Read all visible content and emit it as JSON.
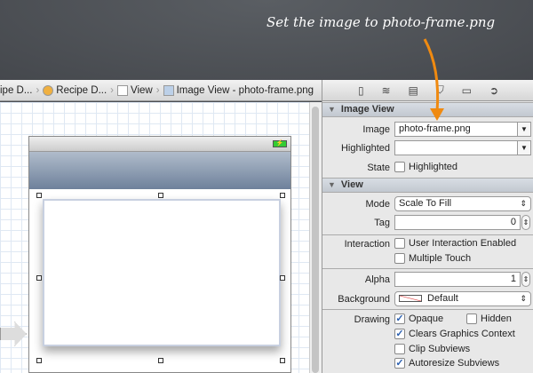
{
  "annotation": "Set the image to photo-frame.png",
  "colors": {
    "arrow": "#f08a10",
    "battery": "#33cc33"
  },
  "breadcrumb": [
    {
      "label": "ipe D...",
      "icon": "storyboard-icon"
    },
    {
      "label": "Recipe D...",
      "icon": "view-controller-icon"
    },
    {
      "label": "View",
      "icon": "view-icon"
    },
    {
      "label": "Image View - photo-frame.png",
      "icon": "image-view-icon"
    }
  ],
  "inspector_tabs": [
    "file-icon",
    "quick-help-icon",
    "identity-icon",
    "attributes-icon",
    "size-icon",
    "connections-icon"
  ],
  "image_view": {
    "title": "Image View",
    "image_label": "Image",
    "image_value": "photo-frame.png",
    "highlighted_label": "Highlighted",
    "highlighted_value": "",
    "state_label": "State",
    "state_option": "Highlighted",
    "state_checked": false
  },
  "view": {
    "title": "View",
    "mode_label": "Mode",
    "mode_value": "Scale To Fill",
    "tag_label": "Tag",
    "tag_value": "0",
    "interaction_label": "Interaction",
    "user_interaction": "User Interaction Enabled",
    "user_interaction_checked": false,
    "multiple_touch": "Multiple Touch",
    "multiple_touch_checked": false,
    "alpha_label": "Alpha",
    "alpha_value": "1",
    "background_label": "Background",
    "background_value": "Default",
    "drawing_label": "Drawing",
    "opaque": "Opaque",
    "opaque_checked": true,
    "hidden": "Hidden",
    "hidden_checked": false,
    "clears": "Clears Graphics Context",
    "clears_checked": true,
    "clip": "Clip Subviews",
    "clip_checked": false,
    "autoresize": "Autoresize Subviews",
    "autoresize_checked": true
  }
}
